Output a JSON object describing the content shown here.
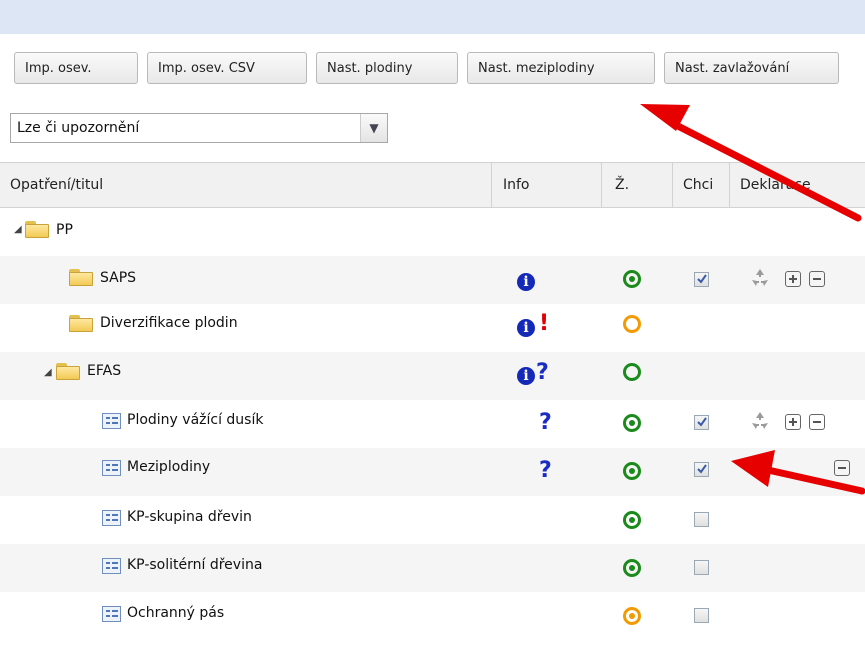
{
  "toolbar": {
    "buttons": [
      "Imp. osev.",
      "Imp. osev. CSV",
      "Nast. plodiny",
      "Nast. meziplodiny",
      "Nast. zavlažování"
    ]
  },
  "filter": {
    "selected": "Lze či upozornění"
  },
  "grid": {
    "columns": {
      "title": "Opatření/titul",
      "info": "Info",
      "z": "Ž.",
      "want": "Chci",
      "declaration": "Deklarace"
    },
    "rows": [
      {
        "label": "PP",
        "type": "folder",
        "expanded": true,
        "info": [],
        "status": null,
        "checked": null,
        "actions": []
      },
      {
        "label": "SAPS",
        "type": "folder",
        "info": [
          "info-icon"
        ],
        "status": "green-dot",
        "checked": true,
        "actions": [
          "recycle-icon",
          "plus-box-icon",
          "minus-box-icon"
        ]
      },
      {
        "label": "Diverzifikace plodin",
        "type": "folder",
        "info": [
          "info-icon",
          "exclamation-icon"
        ],
        "status": "orange-ring",
        "checked": null,
        "actions": []
      },
      {
        "label": "EFAS",
        "type": "folder",
        "expanded": true,
        "info": [
          "info-icon",
          "question-icon"
        ],
        "status": "green-ring",
        "checked": null,
        "actions": []
      },
      {
        "label": "Plodiny vážící dusík",
        "type": "leaf",
        "info": [
          "question-icon"
        ],
        "status": "green-dot",
        "checked": true,
        "actions": [
          "recycle-icon",
          "plus-box-icon",
          "minus-box-icon"
        ]
      },
      {
        "label": "Meziplodiny",
        "type": "leaf",
        "info": [
          "question-icon"
        ],
        "status": "green-dot",
        "checked": true,
        "actions": [
          "minus-box-icon"
        ]
      },
      {
        "label": "KP-skupina dřevin",
        "type": "leaf",
        "info": [],
        "status": "green-dot",
        "checked": false,
        "actions": []
      },
      {
        "label": "KP-solitérní dřevina",
        "type": "leaf",
        "info": [],
        "status": "green-dot",
        "checked": false,
        "actions": []
      },
      {
        "label": "Ochranný pás",
        "type": "leaf",
        "info": [],
        "status": "orange-dot",
        "checked": false,
        "actions": []
      }
    ]
  },
  "colors": {
    "annotation_arrow": "#e60000",
    "status_green": "#1a8a1a",
    "status_orange": "#f39a00",
    "info_blue": "#1529b8"
  }
}
